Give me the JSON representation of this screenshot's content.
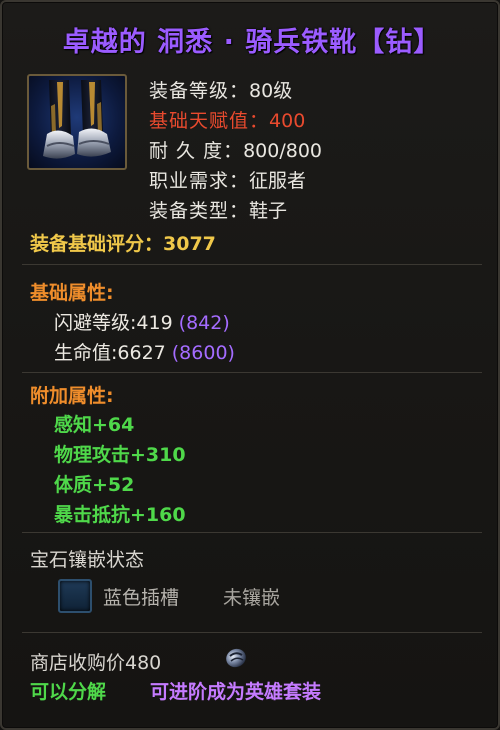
{
  "item": {
    "title": "卓越的 洞悉 · 骑兵铁靴【钻】",
    "icon": "boots-icon"
  },
  "stats": {
    "level_label": "装备等级：",
    "level_value": "80级",
    "talent_label": "基础天赋值：",
    "talent_value": "400",
    "durability_label": "耐 久 度：",
    "durability_value": "800/800",
    "class_label": "职业需求：",
    "class_value": "征服者",
    "type_label": "装备类型：",
    "type_value": "鞋子",
    "score_label": "装备基础评分：",
    "score_value": "3077"
  },
  "base_attributes": {
    "title": "基础属性:",
    "items": [
      {
        "text": "闪避等级:419",
        "max": "(842)"
      },
      {
        "text": "生命值:6627",
        "max": "(8600)"
      }
    ]
  },
  "extra_attributes": {
    "title": "附加属性:",
    "items": [
      {
        "text": "感知+64"
      },
      {
        "text": "物理攻击+310"
      },
      {
        "text": "体质+52"
      },
      {
        "text": "暴击抵抗+160"
      }
    ]
  },
  "gems": {
    "title": "宝石镶嵌状态",
    "slot_label": "蓝色插槽",
    "slot_status": "未镶嵌"
  },
  "footer": {
    "shop_price": "商店收购价480",
    "coin_icon": "coin-icon",
    "decompose": "可以分解",
    "upgrade": "可进阶成为英雄套装"
  },
  "colors": {
    "title": "#9b5cff",
    "talent": "#e84a2e",
    "score": "#f0c84a",
    "section": "#ef8d2b",
    "green": "#4fd84a",
    "purple": "#a46cff"
  }
}
